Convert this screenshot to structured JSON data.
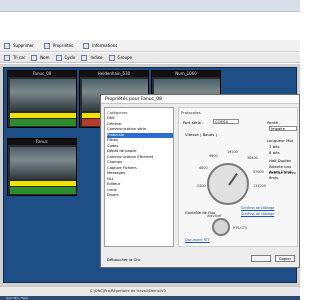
{
  "app": {
    "title": "",
    "toolbar": [
      {
        "label": "Supprimer",
        "icon": "delete-icon"
      },
      {
        "label": "Propriétés",
        "icon": "properties-icon"
      },
      {
        "label": "Informations",
        "icon": "info-icon"
      }
    ],
    "subbar": [
      {
        "label": "Tri car",
        "icon": "sort-icon"
      },
      {
        "label": "Nom",
        "icon": "name-icon"
      },
      {
        "label": "Cycle",
        "icon": "cycle-icon"
      },
      {
        "label": "Indice",
        "icon": "index-icon"
      },
      {
        "label": "Groupe",
        "icon": "group-icon"
      }
    ]
  },
  "workspace": {
    "machines": [
      {
        "title": "Fanuc_08",
        "status": "",
        "bar_color": "#2d8b2d"
      },
      {
        "title": "Heidenhain_530",
        "status": "",
        "bar_color": "#b83a2c"
      },
      {
        "title": "Num_1060",
        "status": "",
        "bar_color": "#2d8b2d"
      },
      {
        "title": "Fanuc",
        "status": "",
        "bar_color": "#2d8b2d"
      }
    ]
  },
  "dialog": {
    "title": "Propriétés pour Fanuc_08",
    "categories_header": "Catégories",
    "properties_header": "Protocoles",
    "tree": [
      "DNC",
      "Général",
      "Communication série",
      "Protocole",
      "Filtres",
      "Codes",
      "Dépôt de papier",
      "Communication Ethernet",
      "Champs",
      "Capture Fichiers",
      "Messages",
      "DLL",
      "Editeur",
      "Liens",
      "Divers"
    ],
    "selected_tree_index": 3,
    "port_serie_label": "Port série :",
    "port_serie_value": "COM10",
    "parite_label": "Parité",
    "parite_value": "Impaire",
    "vitesse_label": "Vitesse ( Bauds )",
    "baud_rates": [
      "2400",
      "4800",
      "9600",
      "19200",
      "38400",
      "57600",
      "115200"
    ],
    "longueur_mot_label": "Longueur Mot",
    "bits_7_label": "7 bits",
    "bits_8_label": "8 bits",
    "half_duplex_label": "Half Duplex",
    "attente_label": "Attente bus Avant Envoi",
    "remise_label": "Remise à zéro émis",
    "controle_flux_label": "Contrôle de flux",
    "link_1": "Schéma de câblage",
    "link_2": "Schéma de câblage",
    "doc_label": "Document RTF",
    "xonxoff_label": "Xon/Xoff",
    "rts_cts_label": "RTS/CTS",
    "ok_label": "",
    "cancel_label": "Copier"
  },
  "status": {
    "path": "C:\\DNC\\Pro\\Répertoire de travail\\Demo\\V0",
    "footer_left": "Déboucher la Cnc",
    "taskbar_text": "Yucc Pro - Fanc"
  }
}
